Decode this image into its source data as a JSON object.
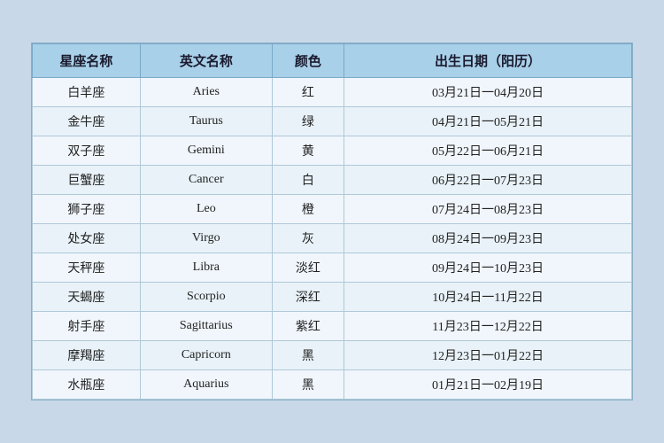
{
  "table": {
    "headers": {
      "zh_name": "星座名称",
      "en_name": "英文名称",
      "color": "颜色",
      "date": "出生日期（阳历）"
    },
    "rows": [
      {
        "zh": "白羊座",
        "en": "Aries",
        "color": "红",
        "date": "03月21日一04月20日"
      },
      {
        "zh": "金牛座",
        "en": "Taurus",
        "color": "绿",
        "date": "04月21日一05月21日"
      },
      {
        "zh": "双子座",
        "en": "Gemini",
        "color": "黄",
        "date": "05月22日一06月21日"
      },
      {
        "zh": "巨蟹座",
        "en": "Cancer",
        "color": "白",
        "date": "06月22日一07月23日"
      },
      {
        "zh": "狮子座",
        "en": "Leo",
        "color": "橙",
        "date": "07月24日一08月23日"
      },
      {
        "zh": "处女座",
        "en": "Virgo",
        "color": "灰",
        "date": "08月24日一09月23日"
      },
      {
        "zh": "天秤座",
        "en": "Libra",
        "color": "淡红",
        "date": "09月24日一10月23日"
      },
      {
        "zh": "天蝎座",
        "en": "Scorpio",
        "color": "深红",
        "date": "10月24日一11月22日"
      },
      {
        "zh": "射手座",
        "en": "Sagittarius",
        "color": "紫红",
        "date": "11月23日一12月22日"
      },
      {
        "zh": "摩羯座",
        "en": "Capricorn",
        "color": "黑",
        "date": "12月23日一01月22日"
      },
      {
        "zh": "水瓶座",
        "en": "Aquarius",
        "color": "黑",
        "date": "01月21日一02月19日"
      }
    ]
  }
}
